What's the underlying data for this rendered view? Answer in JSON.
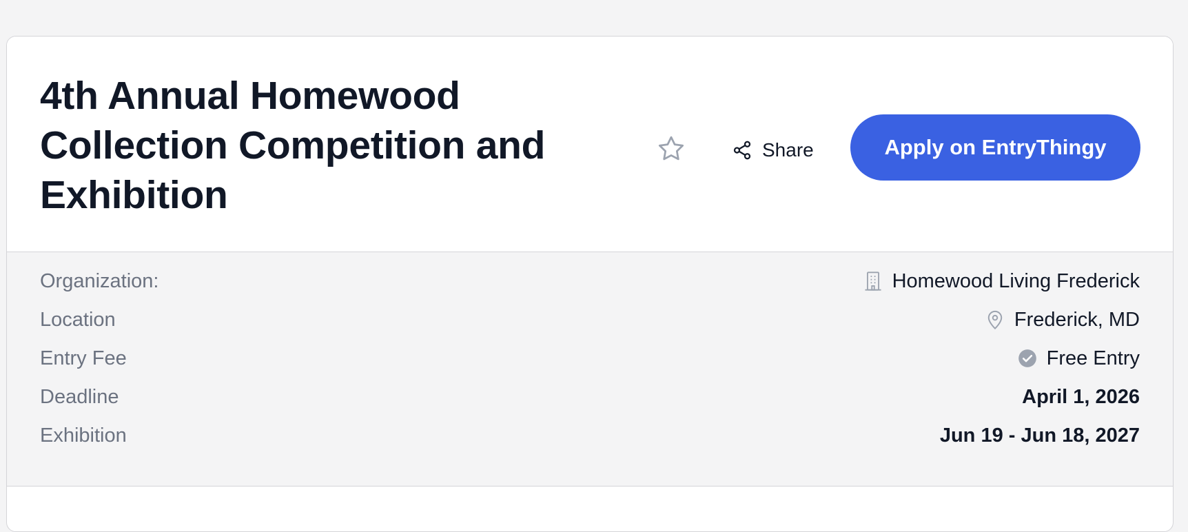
{
  "event": {
    "title": "4th Annual Homewood Collection Competition and Exhibition"
  },
  "actions": {
    "favorite_icon": "star-icon",
    "share_icon": "share-icon",
    "share_label": "Share",
    "apply_label": "Apply on EntryThingy",
    "apply_color": "#3a61e2"
  },
  "details": {
    "organization": {
      "label": "Organization:",
      "value": "Homewood Living Frederick",
      "icon": "building-icon"
    },
    "location": {
      "label": "Location",
      "value": "Frederick, MD",
      "icon": "map-pin-icon"
    },
    "entry_fee": {
      "label": "Entry Fee",
      "value": "Free Entry",
      "icon": "check-circle-icon"
    },
    "deadline": {
      "label": "Deadline",
      "value": "April 1, 2026"
    },
    "exhibition": {
      "label": "Exhibition",
      "value": "Jun 19 - Jun 18, 2027"
    }
  }
}
